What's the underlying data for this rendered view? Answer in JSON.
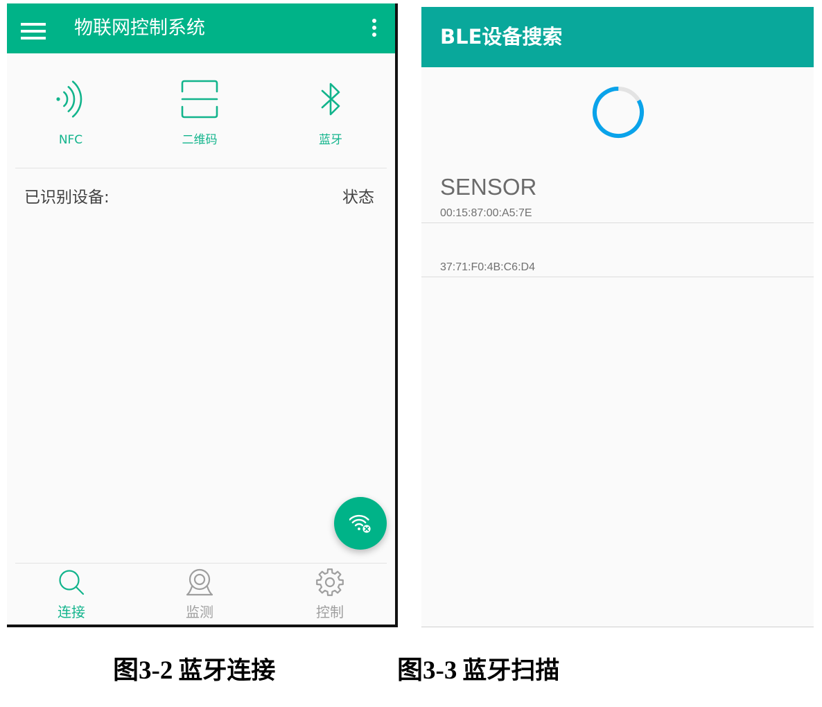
{
  "colors": {
    "left_primary": "#00B388",
    "right_primary": "#09A89B",
    "accent": "#12B48C",
    "background": "#FAFAFA",
    "divider": "#E2E2E2",
    "text_primary": "#424242",
    "text_secondary": "#6B6B6B",
    "text_inactive": "#9E9E9E",
    "spinner_arc": "#0AA3EA",
    "spinner_track": "#E3E3E3",
    "border_black": "#111111"
  },
  "left_screen": {
    "app_bar": {
      "menu_icon": "hamburger-menu-icon",
      "title": "物联网控制系统",
      "overflow_icon": "more-vertical-icon"
    },
    "quick_actions": [
      {
        "icon": "nfc-icon",
        "label": "NFC"
      },
      {
        "icon": "qr-code-scan-icon",
        "label": "二维码"
      },
      {
        "icon": "bluetooth-icon",
        "label": "蓝牙"
      }
    ],
    "device_list": {
      "header": "已识别设备:",
      "status_header": "状态"
    },
    "fab": {
      "icon": "wifi-off-icon"
    },
    "bottom_nav": [
      {
        "icon": "search-icon",
        "label": "连接",
        "active": true
      },
      {
        "icon": "webcam-icon",
        "label": "监测",
        "active": false
      },
      {
        "icon": "gear-icon",
        "label": "控制",
        "active": false
      }
    ]
  },
  "right_screen": {
    "app_bar": {
      "title": "BLE设备搜索"
    },
    "spinner": {
      "icon": "loading-spinner-icon"
    },
    "devices": [
      {
        "name": "SENSOR",
        "address": "00:15:87:00:A5:7E"
      },
      {
        "address": "37:71:F0:4B:C6:D4"
      }
    ]
  },
  "captions": [
    {
      "figure": "图3-2",
      "title": "蓝牙连接"
    },
    {
      "figure": "图3-3",
      "title": "蓝牙扫描"
    }
  ]
}
